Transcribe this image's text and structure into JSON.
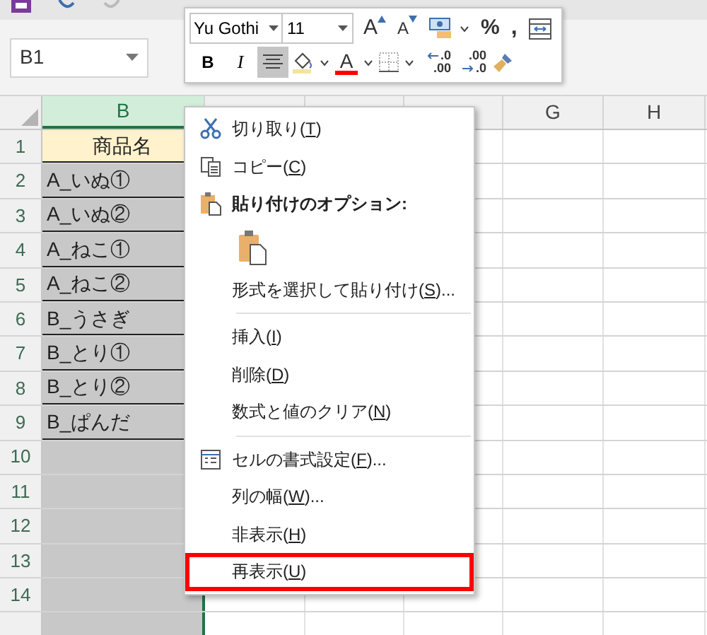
{
  "name_box": {
    "value": "B1"
  },
  "mini_toolbar": {
    "font": "Yu Gothi",
    "size": "11",
    "row1": [
      {
        "kind": "grow",
        "label": "A"
      },
      {
        "kind": "shrink",
        "label": "A"
      },
      {
        "kind": "accounting"
      },
      {
        "kind": "percent",
        "label": "%"
      },
      {
        "kind": "comma",
        "label": ","
      },
      {
        "kind": "wrap"
      }
    ],
    "row2": [
      {
        "kind": "bold",
        "label": "B",
        "selected": false
      },
      {
        "kind": "italic",
        "label": "I",
        "selected": false
      },
      {
        "kind": "center",
        "selected": true
      },
      {
        "kind": "fill"
      },
      {
        "kind": "font_color",
        "label": "A"
      },
      {
        "kind": "borders"
      },
      {
        "kind": "inc_decimal",
        "top": ".0",
        "bottom": ".00"
      },
      {
        "kind": "dec_decimal",
        "top": ".00",
        "bottom": ".0"
      },
      {
        "kind": "painter"
      }
    ]
  },
  "columns": [
    {
      "label": "B",
      "selected": true
    },
    {
      "label": "G",
      "selected": false
    },
    {
      "label": "H",
      "selected": false
    }
  ],
  "rows": [
    {
      "number": "1",
      "cell": "商品名",
      "kind": "header"
    },
    {
      "number": "2",
      "cell": "A_いぬ①",
      "kind": "data"
    },
    {
      "number": "3",
      "cell": "A_いぬ②",
      "kind": "data"
    },
    {
      "number": "4",
      "cell": "A_ねこ①",
      "kind": "data"
    },
    {
      "number": "5",
      "cell": "A_ねこ②",
      "kind": "data"
    },
    {
      "number": "6",
      "cell": "B_うさぎ",
      "kind": "data"
    },
    {
      "number": "7",
      "cell": "B_とり①",
      "kind": "data"
    },
    {
      "number": "8",
      "cell": "B_とり②",
      "kind": "data"
    },
    {
      "number": "9",
      "cell": "B_ぱんだ",
      "kind": "data"
    },
    {
      "number": "10",
      "kind": "empty"
    },
    {
      "number": "11",
      "kind": "empty"
    },
    {
      "number": "12",
      "kind": "empty"
    },
    {
      "number": "13",
      "kind": "empty"
    },
    {
      "number": "14",
      "kind": "empty"
    },
    {
      "kind": "empty"
    }
  ],
  "context_menu": [
    {
      "kind": "cut",
      "before": "切り取り(",
      "key": "T",
      "after": ")",
      "highlighted": false
    },
    {
      "kind": "copy",
      "before": "コピー(",
      "key": "C",
      "after": ")",
      "highlighted": false
    },
    {
      "kind": "paste_heading",
      "before": "貼り付けのオプション:",
      "highlighted": false
    },
    {
      "kind": "paste_option"
    },
    {
      "kind": "plain",
      "before": "形式を選択して貼り付け(",
      "key": "S",
      "after": ")...",
      "highlighted": false
    },
    {
      "kind": "separator"
    },
    {
      "kind": "plain",
      "before": "挿入(",
      "key": "I",
      "after": ")",
      "highlighted": false
    },
    {
      "kind": "plain",
      "before": "削除(",
      "key": "D",
      "after": ")",
      "highlighted": false
    },
    {
      "kind": "plain",
      "before": "数式と値のクリア(",
      "key": "N",
      "after": ")",
      "highlighted": false
    },
    {
      "kind": "separator"
    },
    {
      "kind": "format",
      "before": "セルの書式設定(",
      "key": "F",
      "after": ")...",
      "highlighted": false
    },
    {
      "kind": "plain",
      "before": "列の幅(",
      "key": "W",
      "after": ")...",
      "highlighted": false
    },
    {
      "kind": "plain",
      "before": "非表示(",
      "key": "H",
      "after": ")",
      "highlighted": false
    },
    {
      "kind": "plain",
      "before": "再表示(",
      "key": "U",
      "after": ")",
      "highlighted": true
    }
  ]
}
